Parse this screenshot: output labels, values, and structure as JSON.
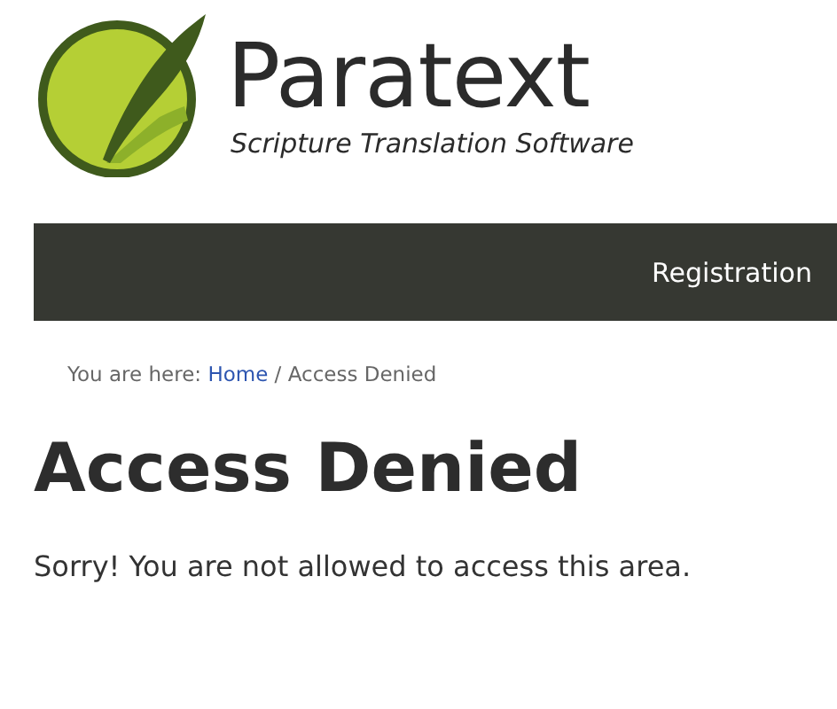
{
  "logo": {
    "name": "Paratext",
    "tagline": "Scripture Translation Software"
  },
  "nav": {
    "items": [
      {
        "label": "Registration"
      }
    ]
  },
  "breadcrumb": {
    "label": "You are here:",
    "separator": "/",
    "items": [
      {
        "text": "Home",
        "kind": "link"
      },
      {
        "text": "Access Denied",
        "kind": "current"
      }
    ]
  },
  "heading": "Access Denied",
  "message": "Sorry! You are not allowed to access this area."
}
